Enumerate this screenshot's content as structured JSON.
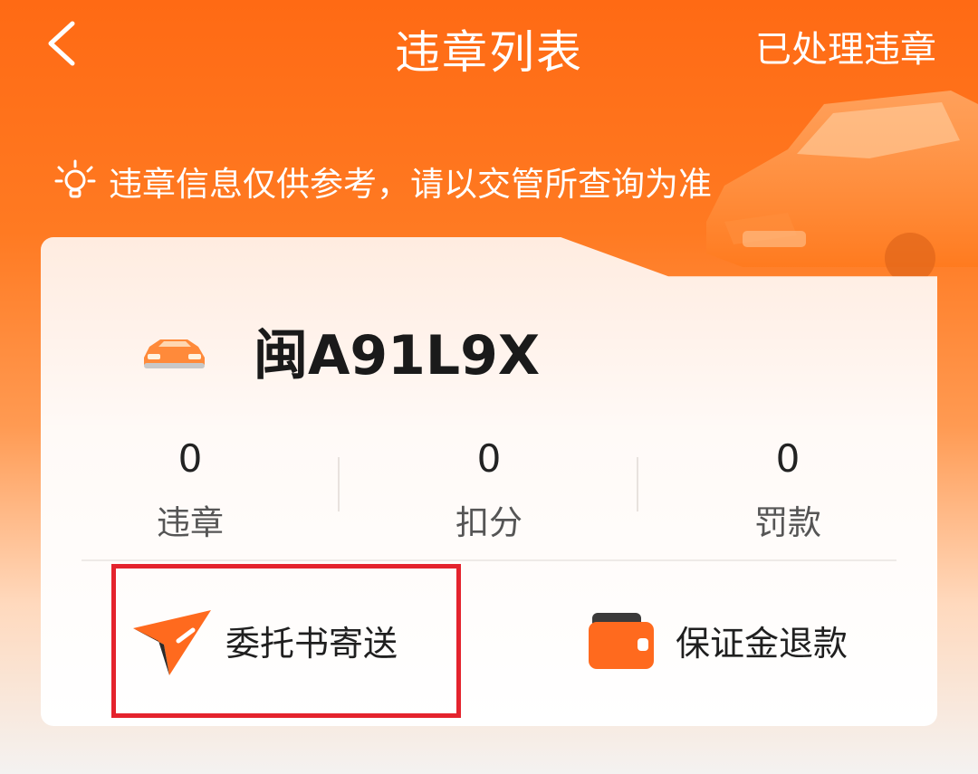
{
  "header": {
    "back_icon": "chevron-left-icon",
    "title": "违章列表",
    "processed_link": "已处理违章"
  },
  "notice": {
    "icon": "lightbulb-icon",
    "text": "违章信息仅供参考，请以交管所查询为准"
  },
  "vehicle": {
    "icon": "car-icon",
    "plate": "闽A91L9X"
  },
  "stats": [
    {
      "value": "0",
      "label": "违章"
    },
    {
      "value": "0",
      "label": "扣分"
    },
    {
      "value": "0",
      "label": "罚款"
    }
  ],
  "actions": [
    {
      "icon": "paper-plane-icon",
      "label": "委托书寄送",
      "highlighted": true
    },
    {
      "icon": "wallet-icon",
      "label": "保证金退款",
      "highlighted": false
    }
  ],
  "colors": {
    "brand_orange": "#ff6a14",
    "highlight_red": "#e4232d"
  }
}
